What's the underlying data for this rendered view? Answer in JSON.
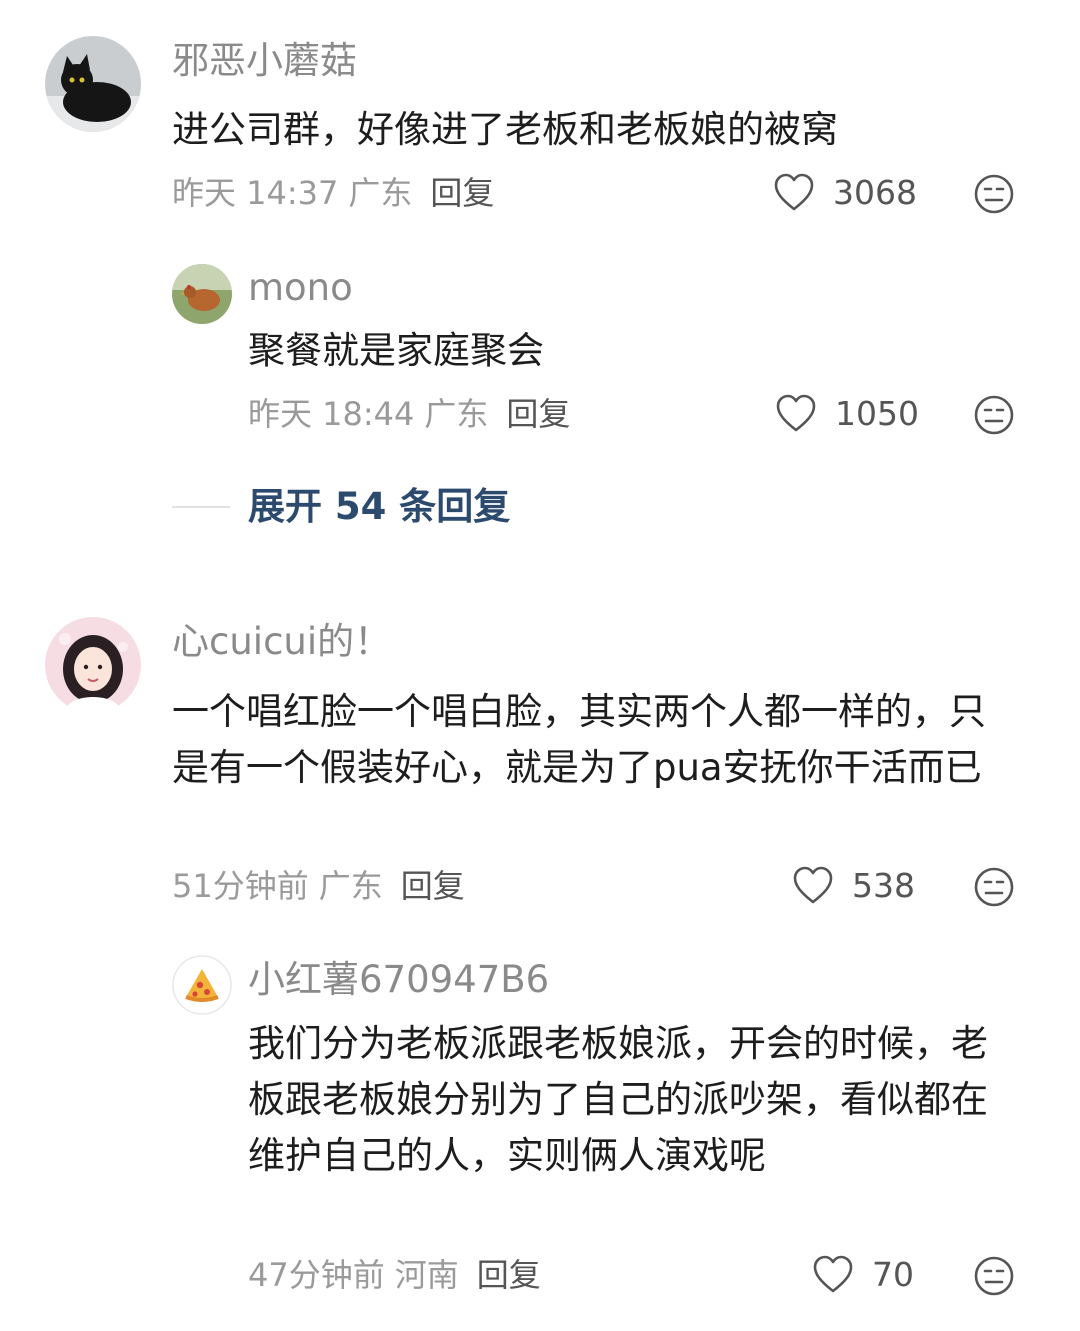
{
  "comments": [
    {
      "username": "邪恶小蘑菇",
      "text": "进公司群，好像进了老板和老板娘的被窝",
      "time": "昨天 14:37",
      "location": "广东",
      "reply_label": "回复",
      "likes": "3068",
      "avatar_icon": "black-cat-avatar"
    },
    {
      "username": "mono",
      "text": "聚餐就是家庭聚会",
      "time": "昨天 18:44",
      "location": "广东",
      "reply_label": "回复",
      "likes": "1050",
      "avatar_icon": "chicken-avatar"
    },
    {
      "username": "心cuicui的！",
      "text": "一个唱红脸一个唱白脸，其实两个人都一样的，只是有一个假装好心，就是为了pua安抚你干活而已",
      "time": "51分钟前",
      "location": "广东",
      "reply_label": "回复",
      "likes": "538",
      "avatar_icon": "anime-girl-avatar"
    },
    {
      "username": "小红薯670947B6",
      "text": "我们分为老板派跟老板娘派，开会的时候，老板跟老板娘分别为了自己的派吵架，看似都在维护自己的人，实则俩人演戏呢",
      "time": "47分钟前",
      "location": "河南",
      "reply_label": "回复",
      "likes": "70",
      "avatar_icon": "pizza-avatar"
    }
  ],
  "expand_replies": "展开 54 条回复",
  "icons": {
    "like": "heart-icon",
    "emoji": "emoji-face-icon"
  }
}
